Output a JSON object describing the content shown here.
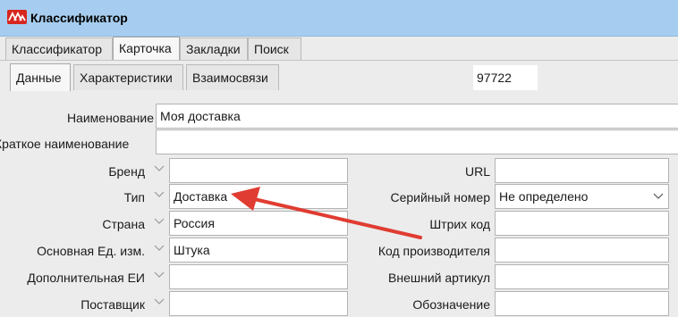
{
  "window": {
    "title": "Классификатор"
  },
  "main_tabs": [
    "Классификатор",
    "Карточка",
    "Закладки",
    "Поиск"
  ],
  "sub_tabs": [
    "Данные",
    "Характеристики",
    "Взаимосвязи"
  ],
  "record_code": "97722",
  "fields": {
    "name": {
      "label": "Наименование",
      "value": "Моя доставка"
    },
    "short_name": {
      "label": "Краткое наименование",
      "value": ""
    },
    "brand": {
      "label": "Бренд",
      "value": ""
    },
    "type": {
      "label": "Тип",
      "value": "Доставка"
    },
    "country": {
      "label": "Страна",
      "value": "Россия"
    },
    "base_unit": {
      "label": "Основная Ед. изм.",
      "value": "Штука"
    },
    "extra_unit": {
      "label": "Дополнительная ЕИ",
      "value": ""
    },
    "supplier": {
      "label": "Поставщик",
      "value": ""
    },
    "url": {
      "label": "URL",
      "value": ""
    },
    "serial": {
      "label": "Серийный номер",
      "value": "Не определено"
    },
    "barcode": {
      "label": "Штрих код",
      "value": ""
    },
    "maker_code": {
      "label": "Код производителя",
      "value": ""
    },
    "ext_article": {
      "label": "Внешний артикул",
      "value": ""
    },
    "designation": {
      "label": "Обозначение",
      "value": ""
    }
  },
  "annotation": {
    "arrow_color": "#e03c31"
  }
}
